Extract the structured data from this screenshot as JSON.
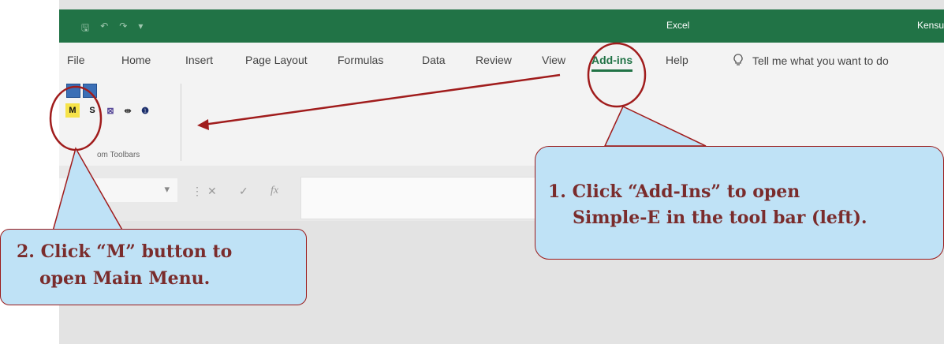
{
  "window": {
    "title": "Excel",
    "user": "Kensu"
  },
  "qat": {
    "save": "🖫",
    "undo": "↶",
    "redo": "↷",
    "customize": "▾"
  },
  "tabs": [
    "File",
    "Home",
    "Insert",
    "Page Layout",
    "Formulas",
    "Data",
    "Review",
    "View",
    "Add-ins",
    "Help"
  ],
  "active_tab": "Add-ins",
  "tell_me": {
    "icon": "lightbulb-icon",
    "text": "Tell me what you want to do"
  },
  "ribbon": {
    "group_label": "om Toolbars",
    "buttons": [
      {
        "label": "M",
        "name": "main-menu-button"
      },
      {
        "label": "S",
        "name": "s-button"
      },
      {
        "label": "⊠",
        "name": "chart-button"
      },
      {
        "label": "⇹",
        "name": "arrow-button"
      },
      {
        "label": "❶",
        "name": "info-button"
      }
    ]
  },
  "formula_bar": {
    "dropdown": "▾",
    "sep": "⋮",
    "cancel": "✕",
    "enter": "✓",
    "fx": "fx"
  },
  "callouts": {
    "addins": [
      "1. Click “Add-Ins” to open",
      "Simple-E in the tool bar (left)."
    ],
    "mbutton": [
      "2. Click “M” button to",
      "open Main Menu."
    ]
  },
  "colors": {
    "excel_green": "#217346",
    "callout_fill": "#bfe2f6",
    "annotation_red": "#a01c1c",
    "callout_text": "#7a2c2c"
  }
}
